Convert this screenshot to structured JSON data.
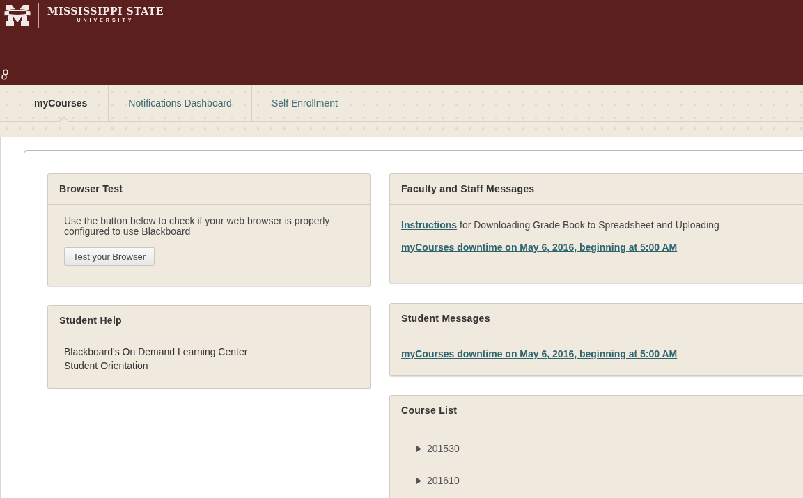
{
  "header": {
    "title": "MISSISSIPPI STATE",
    "subtitle": "UNIVERSITY"
  },
  "tabs": [
    {
      "label": "myCourses",
      "selected": true
    },
    {
      "label": "Notifications Dashboard",
      "selected": false
    },
    {
      "label": "Self Enrollment",
      "selected": false
    }
  ],
  "left_modules": [
    {
      "kind": "browser_test",
      "title": "Browser Test",
      "text": "Use the button below to check if your web browser is properly configured to use Blackboard",
      "button": "Test your Browser"
    },
    {
      "kind": "links",
      "title": "Student Help",
      "items": [
        "Blackboard's On Demand Learning Center",
        "Student Orientation"
      ]
    }
  ],
  "right_modules": [
    {
      "kind": "messages",
      "title": "Faculty and Staff Messages",
      "messages": [
        {
          "link": "Instructions",
          "text": "for Downloading Grade Book to Spreadsheet and Uploading"
        },
        {
          "link": "myCourses downtime on May 6, 2016, beginning at 5:00 AM"
        }
      ]
    },
    {
      "kind": "messages",
      "title": "Student Messages",
      "messages": [
        {
          "link": "myCourses downtime on May 6, 2016, beginning at 5:00 AM"
        }
      ]
    },
    {
      "kind": "courses",
      "title": "Course List",
      "items": [
        {
          "label": "201530",
          "expanded": false
        },
        {
          "label": "201610",
          "expanded": false
        }
      ]
    }
  ]
}
